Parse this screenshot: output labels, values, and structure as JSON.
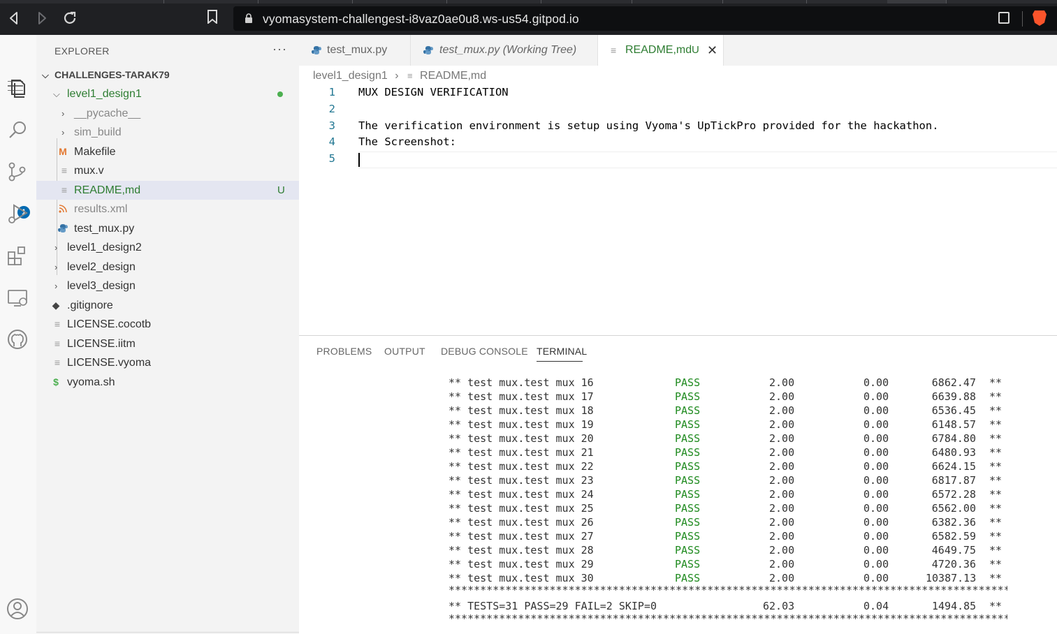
{
  "browser": {
    "url": "vyomasystem-challengest-i8vaz0ae0u8.ws-us54.gitpod.io"
  },
  "activity_bar": {
    "source_control_badge": "1"
  },
  "sidebar": {
    "title": "EXPLORER",
    "more": "···",
    "root": "CHALLENGES-TARAK79",
    "items": [
      {
        "label": "level1_design1",
        "type": "folder-open"
      },
      {
        "label": "__pycache__",
        "type": "folder"
      },
      {
        "label": "sim_build",
        "type": "folder"
      },
      {
        "label": "Makefile",
        "type": "makefile"
      },
      {
        "label": "mux.v",
        "type": "file"
      },
      {
        "label": "README,md",
        "type": "file",
        "status": "U"
      },
      {
        "label": "results.xml",
        "type": "rss"
      },
      {
        "label": "test_mux.py",
        "type": "python"
      },
      {
        "label": "level1_design2",
        "type": "folder"
      },
      {
        "label": "level2_design",
        "type": "folder"
      },
      {
        "label": "level3_design",
        "type": "folder"
      },
      {
        "label": ".gitignore",
        "type": "git"
      },
      {
        "label": "LICENSE.cocotb",
        "type": "file"
      },
      {
        "label": "LICENSE.iitm",
        "type": "file"
      },
      {
        "label": "LICENSE.vyoma",
        "type": "file"
      },
      {
        "label": "vyoma.sh",
        "type": "shell"
      }
    ],
    "makefile_glyph": "M",
    "shell_glyph": "$"
  },
  "tabs": [
    {
      "label": "test_mux.py"
    },
    {
      "label": "test_mux.py (Working Tree)"
    },
    {
      "label": "README,md",
      "status": "U"
    }
  ],
  "breadcrumb": {
    "folder": "level1_design1",
    "file": "README,md"
  },
  "editor": {
    "lines": [
      {
        "n": "1",
        "text": "MUX DESIGN VERIFICATION"
      },
      {
        "n": "2",
        "text": ""
      },
      {
        "n": "3",
        "text": "The verification environment is setup using Vyoma's UpTickPro provided for the hackathon."
      },
      {
        "n": "4",
        "text": "The Screenshot:"
      },
      {
        "n": "5",
        "text": ""
      }
    ]
  },
  "panel": {
    "tabs": [
      "PROBLEMS",
      "OUTPUT",
      "DEBUG CONSOLE",
      "TERMINAL"
    ],
    "active_tab": "TERMINAL"
  },
  "terminal": {
    "rows": [
      {
        "test": "** test mux.test mux 16",
        "result": "PASS",
        "sim_time": "2.00",
        "real_time": "0.00",
        "ratio": "6862.47",
        "end": "**"
      },
      {
        "test": "** test mux.test mux 17",
        "result": "PASS",
        "sim_time": "2.00",
        "real_time": "0.00",
        "ratio": "6639.88",
        "end": "**"
      },
      {
        "test": "** test mux.test mux 18",
        "result": "PASS",
        "sim_time": "2.00",
        "real_time": "0.00",
        "ratio": "6536.45",
        "end": "**"
      },
      {
        "test": "** test mux.test mux 19",
        "result": "PASS",
        "sim_time": "2.00",
        "real_time": "0.00",
        "ratio": "6148.57",
        "end": "**"
      },
      {
        "test": "** test mux.test mux 20",
        "result": "PASS",
        "sim_time": "2.00",
        "real_time": "0.00",
        "ratio": "6784.80",
        "end": "**"
      },
      {
        "test": "** test mux.test mux 21",
        "result": "PASS",
        "sim_time": "2.00",
        "real_time": "0.00",
        "ratio": "6480.93",
        "end": "**"
      },
      {
        "test": "** test mux.test mux 22",
        "result": "PASS",
        "sim_time": "2.00",
        "real_time": "0.00",
        "ratio": "6624.15",
        "end": "**"
      },
      {
        "test": "** test mux.test mux 23",
        "result": "PASS",
        "sim_time": "2.00",
        "real_time": "0.00",
        "ratio": "6817.87",
        "end": "**"
      },
      {
        "test": "** test mux.test mux 24",
        "result": "PASS",
        "sim_time": "2.00",
        "real_time": "0.00",
        "ratio": "6572.28",
        "end": "**"
      },
      {
        "test": "** test mux.test mux 25",
        "result": "PASS",
        "sim_time": "2.00",
        "real_time": "0.00",
        "ratio": "6562.00",
        "end": "**"
      },
      {
        "test": "** test mux.test mux 26",
        "result": "PASS",
        "sim_time": "2.00",
        "real_time": "0.00",
        "ratio": "6382.36",
        "end": "**"
      },
      {
        "test": "** test mux.test mux 27",
        "result": "PASS",
        "sim_time": "2.00",
        "real_time": "0.00",
        "ratio": "6582.59",
        "end": "**"
      },
      {
        "test": "** test mux.test mux 28",
        "result": "PASS",
        "sim_time": "2.00",
        "real_time": "0.00",
        "ratio": "4649.75",
        "end": "**"
      },
      {
        "test": "** test mux.test mux 29",
        "result": "PASS",
        "sim_time": "2.00",
        "real_time": "0.00",
        "ratio": "4720.36",
        "end": "**"
      },
      {
        "test": "** test mux.test mux 30",
        "result": "PASS",
        "sim_time": "2.00",
        "real_time": "0.00",
        "ratio": "10387.13",
        "end": "**"
      }
    ],
    "separator": "**************************************************************************************************",
    "summary": {
      "text": "** TESTS=31 PASS=29 FAIL=2 SKIP=0",
      "sim_time": "62.03",
      "real_time": "0.04",
      "ratio": "1494.85",
      "end": "**"
    }
  }
}
